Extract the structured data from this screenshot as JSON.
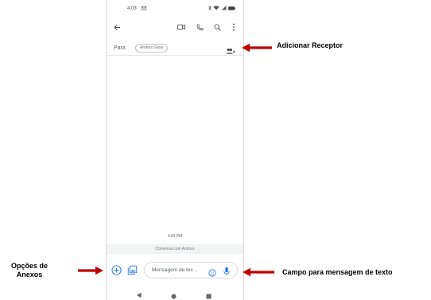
{
  "status_bar": {
    "time": "4:03"
  },
  "recipient_row": {
    "to_label": "Para",
    "chip_text": "Andres Gosa"
  },
  "conversation": {
    "timestamp": "4:03 PM",
    "hint": "Conversa com Andres"
  },
  "compose": {
    "placeholder": "Mensagem de tex..."
  },
  "annotations": {
    "add_recipient": "Adicionar Receptor",
    "attachment_options": "Opções de Anexos",
    "text_field": "Campo para mensagem de texto"
  },
  "colors": {
    "arrow": "#c00000",
    "accent": "#1a73e8"
  }
}
